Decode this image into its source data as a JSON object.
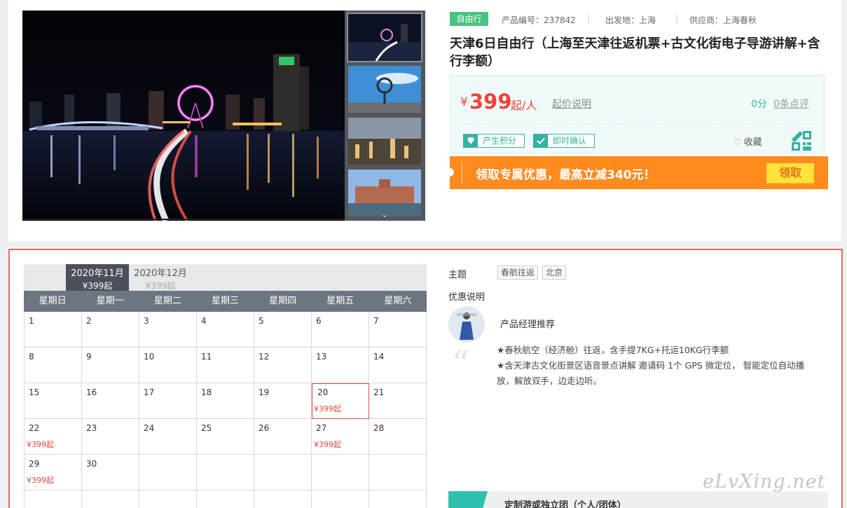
{
  "meta": {
    "badge": "自由行",
    "product_code": "产品编号：237842",
    "origin": "出发地：上海",
    "supplier": "供应商：上海春秋",
    "separator": "|"
  },
  "title": "天津6日自由行（上海至天津往返机票+古文化街电子导游讲解+含行李额）",
  "price": {
    "currency": "¥",
    "amount": "399",
    "unit": "起/人",
    "note": "起价说明",
    "score": "0分",
    "reviews": "0条点评"
  },
  "tags": {
    "points": "产生积分",
    "instant": "即时确认"
  },
  "favorite": "收藏",
  "promo": {
    "text": "领取专属优惠，最高立减340元！",
    "button": "领取"
  },
  "gallery": {
    "more_arrow": "⌄"
  },
  "calendar": {
    "months": [
      {
        "label": "2020年11月",
        "price": "¥399起"
      },
      {
        "label": "2020年12月",
        "price": "¥399起"
      }
    ],
    "weekdays": [
      "星期日",
      "星期一",
      "星期二",
      "星期三",
      "星期四",
      "星期五",
      "星期六"
    ],
    "days": [
      {
        "n": "1",
        "p": ""
      },
      {
        "n": "2",
        "p": ""
      },
      {
        "n": "3",
        "p": ""
      },
      {
        "n": "4",
        "p": ""
      },
      {
        "n": "5",
        "p": ""
      },
      {
        "n": "6",
        "p": ""
      },
      {
        "n": "7",
        "p": ""
      },
      {
        "n": "8",
        "p": ""
      },
      {
        "n": "9",
        "p": ""
      },
      {
        "n": "10",
        "p": ""
      },
      {
        "n": "11",
        "p": ""
      },
      {
        "n": "12",
        "p": ""
      },
      {
        "n": "13",
        "p": ""
      },
      {
        "n": "14",
        "p": ""
      },
      {
        "n": "15",
        "p": ""
      },
      {
        "n": "16",
        "p": ""
      },
      {
        "n": "17",
        "p": ""
      },
      {
        "n": "18",
        "p": ""
      },
      {
        "n": "19",
        "p": ""
      },
      {
        "n": "20",
        "p": "¥399起",
        "sel": true
      },
      {
        "n": "21",
        "p": ""
      },
      {
        "n": "22",
        "p": "¥399起"
      },
      {
        "n": "23",
        "p": ""
      },
      {
        "n": "24",
        "p": ""
      },
      {
        "n": "25",
        "p": ""
      },
      {
        "n": "26",
        "p": ""
      },
      {
        "n": "27",
        "p": "¥399起"
      },
      {
        "n": "28",
        "p": ""
      },
      {
        "n": "29",
        "p": "¥399起"
      },
      {
        "n": "30",
        "p": ""
      },
      {
        "n": "",
        "p": ""
      },
      {
        "n": "",
        "p": ""
      },
      {
        "n": "",
        "p": ""
      },
      {
        "n": "",
        "p": ""
      },
      {
        "n": "",
        "p": ""
      },
      {
        "n": "",
        "p": ""
      },
      {
        "n": "",
        "p": ""
      },
      {
        "n": "",
        "p": ""
      },
      {
        "n": "",
        "p": ""
      },
      {
        "n": "",
        "p": ""
      },
      {
        "n": "",
        "p": ""
      },
      {
        "n": "",
        "p": ""
      }
    ]
  },
  "side": {
    "theme_label": "主题",
    "themes": [
      "春航往返",
      "北京"
    ],
    "promo_label": "优惠说明",
    "manager": "产品经理推荐",
    "quote_mark": "“",
    "desc_lines": [
      "★春秋航空（经济舱）往返，含手提7KG+托运10KG行李额",
      "★含天津古文化街景区语音景点讲解 邀请码 1个 GPS 微定位， 智能定位自动播放，解放双手，边走边听。"
    ],
    "custom_tour": "定制游或独立团（个人/团体）"
  },
  "watermark": "eLvXing.net",
  "colors": {
    "price_red": "#f0433a",
    "teal": "#37b0a4",
    "promo_orange": "#ff8b1e",
    "promo_button": "#ffe23a",
    "selected_border": "#e04a3d",
    "card_border": "#e56d55"
  }
}
